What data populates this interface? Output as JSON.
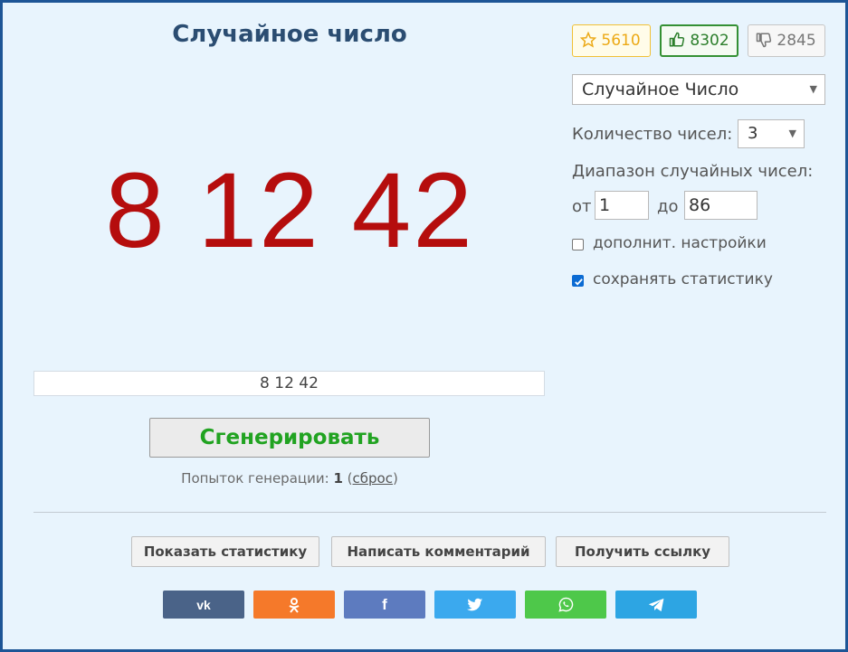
{
  "title": "Случайное число",
  "result_large": "8 12 42",
  "result_text": "8 12 42",
  "generate_button": "Сгенерировать",
  "attempts": {
    "label": "Попыток генерации:",
    "count": "1",
    "open_paren": "(",
    "reset_link": "сброс",
    "close_paren": ")"
  },
  "votes": {
    "favorites": "5610",
    "likes": "8302",
    "dislikes": "2845"
  },
  "generator_select": {
    "value": "Случайное Число"
  },
  "count_field": {
    "label": "Количество чисел:",
    "value": "3"
  },
  "range": {
    "label": "Диапазон случайных чисел:",
    "from_label": "от",
    "from_value": "1",
    "to_label": "до",
    "to_value": "86"
  },
  "options": [
    {
      "label": "дополнит. настройки",
      "checked": false
    },
    {
      "label": "сохранять статистику",
      "checked": true
    }
  ],
  "actions": [
    "Показать статистику",
    "Написать комментарий",
    "Получить ссылку"
  ],
  "social": [
    {
      "icon": "vk-icon",
      "color": "#4a6388"
    },
    {
      "icon": "odnoklassniki-icon",
      "color": "#f5792a"
    },
    {
      "icon": "facebook-icon",
      "color": "#5d7bbf"
    },
    {
      "icon": "twitter-icon",
      "color": "#3ba9ee"
    },
    {
      "icon": "whatsapp-icon",
      "color": "#4ec84a"
    },
    {
      "icon": "telegram-icon",
      "color": "#2da5e3"
    }
  ],
  "colors": {
    "accent_red": "#b50d0d",
    "accent_green": "#21a321",
    "border_blue": "#1d5596"
  }
}
